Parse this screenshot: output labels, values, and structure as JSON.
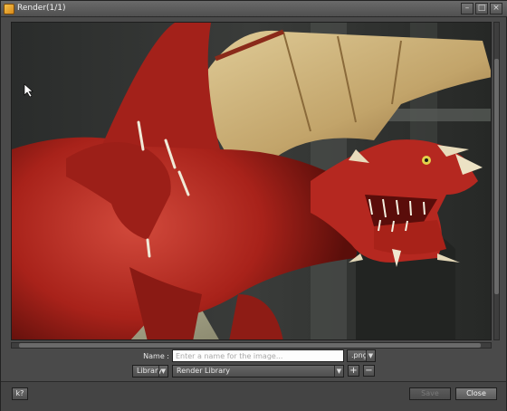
{
  "window": {
    "title": "Render(1/1)"
  },
  "titlebar_buttons": {
    "minimize": "–",
    "maximize": "□",
    "close": "×"
  },
  "render_form": {
    "name_label": "Name :",
    "name_placeholder": "Enter a name for the image...",
    "name_value": "",
    "format": ".png",
    "location": "Library",
    "library": "Render Library",
    "add_label": "+",
    "remove_label": "−"
  },
  "buttons": {
    "help": "k?",
    "save": "Save",
    "close": "Close"
  },
  "colors": {
    "window_bg": "#4a4a4a",
    "dragon_red": "#b8261e",
    "wing_tan": "#c9b27a"
  },
  "icons": {
    "window": "render-app-icon",
    "help": "help-icon"
  }
}
